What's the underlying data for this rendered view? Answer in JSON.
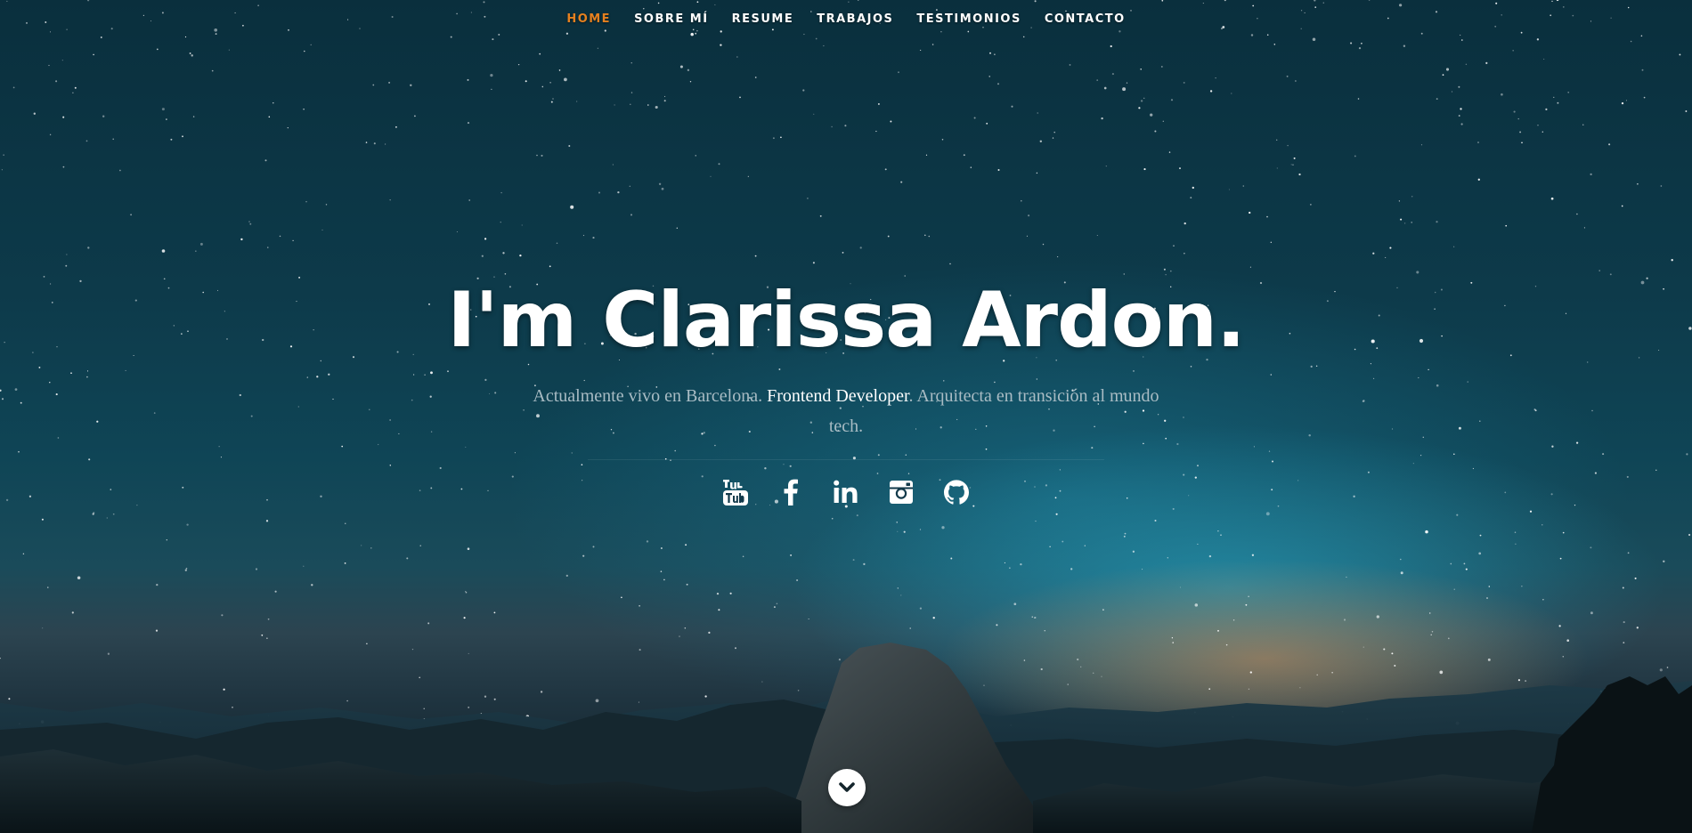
{
  "nav": {
    "items": [
      {
        "label": "HOME",
        "active": true
      },
      {
        "label": "SOBRE MÍ",
        "active": false
      },
      {
        "label": "RESUME",
        "active": false
      },
      {
        "label": "TRABAJOS",
        "active": false
      },
      {
        "label": "TESTIMONIOS",
        "active": false
      },
      {
        "label": "CONTACTO",
        "active": false
      }
    ],
    "active_color": "#e5801f",
    "text_color": "#ffffff"
  },
  "hero": {
    "headline": "I'm Clarissa Ardon.",
    "intro_before": "Actualmente vivo en Barcelona. ",
    "intro_highlight": "Frontend Developer",
    "intro_after": ". Arquitecta en transición al mundo tech."
  },
  "social": {
    "icons": [
      "youtube-icon",
      "facebook-icon",
      "linkedin-icon",
      "instagram-icon",
      "github-icon"
    ]
  },
  "scroll_down": {
    "icon": "chevron-down-icon"
  }
}
